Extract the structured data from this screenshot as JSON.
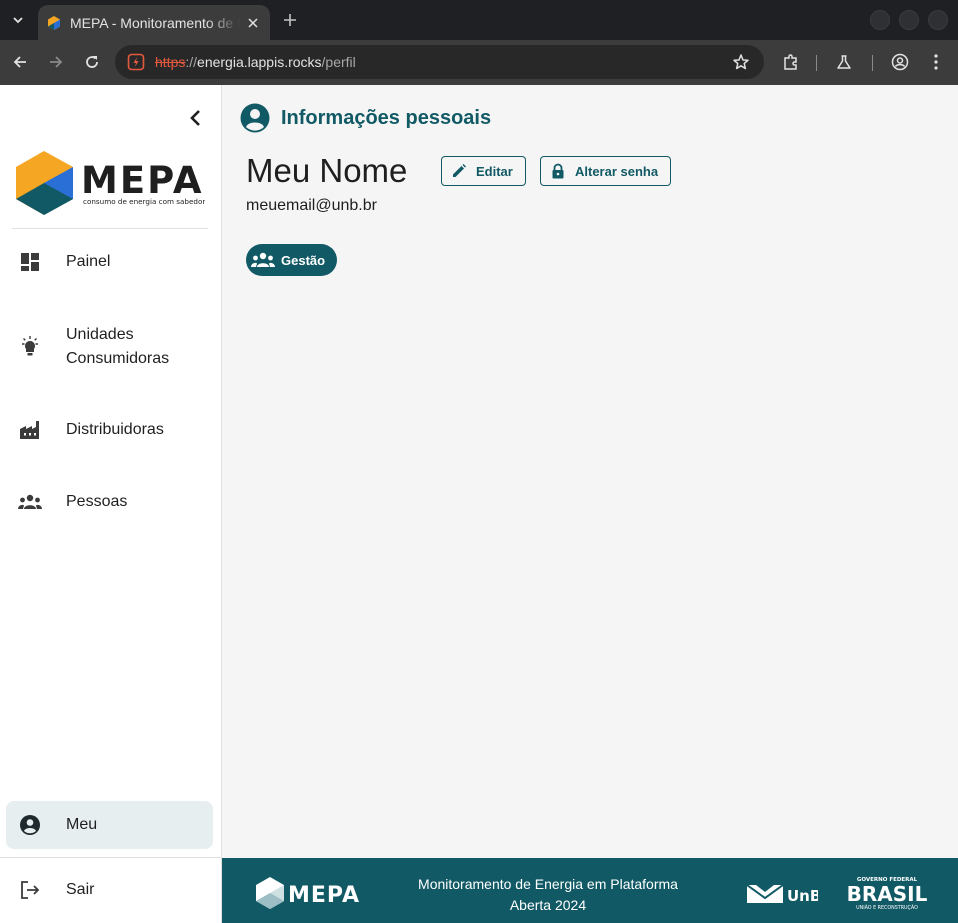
{
  "browser": {
    "tab_title": "MEPA - Monitoramento de Energia em Plataforma Aberta",
    "url_scheme": "https",
    "url_sep": "://",
    "url_host": "energia.lappis.rocks",
    "url_path": "/perfil"
  },
  "sidebar": {
    "logo_text": "MEPA",
    "logo_tagline": "consumo de energia com sabedoria",
    "items": [
      {
        "label": "Painel",
        "icon": "dashboard-icon"
      },
      {
        "label": "Unidades Consumidoras",
        "icon": "lightbulb-icon"
      },
      {
        "label": "Distribuidoras",
        "icon": "factory-icon"
      },
      {
        "label": "Pessoas",
        "icon": "people-icon"
      }
    ],
    "bottom_items": [
      {
        "label": "Meu",
        "icon": "account-circle-icon",
        "active": true
      },
      {
        "label": "Sair",
        "icon": "logout-icon"
      }
    ]
  },
  "profile": {
    "section_title": "Informações pessoais",
    "name": "Meu Nome",
    "edit_label": "Editar",
    "change_password_label": "Alterar senha",
    "email": "meuemail@unb.br",
    "role_chip": "Gestão"
  },
  "footer": {
    "logo_text": "MEPA",
    "line1": "Monitoramento de Energia em Plataforma",
    "line2": "Aberta 2024",
    "unb_text": "UnB",
    "gov_top": "GOVERNO FEDERAL",
    "gov_main": "BRASIL",
    "gov_sub": "UNIÃO E RECONSTRUÇÃO"
  },
  "colors": {
    "primary": "#115a65",
    "logo_orange": "#f5a623",
    "logo_blue": "#2a6fd6",
    "sidebar_active_bg": "#e6eef0"
  }
}
